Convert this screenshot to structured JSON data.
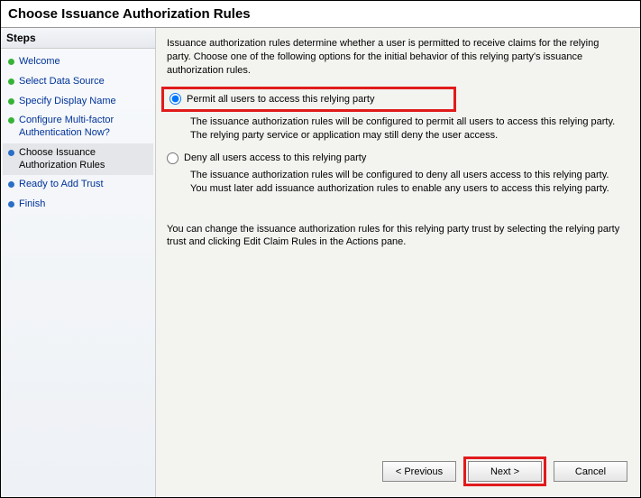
{
  "title": "Choose Issuance Authorization Rules",
  "sidebar": {
    "header": "Steps",
    "items": [
      {
        "label": "Welcome",
        "state": "done"
      },
      {
        "label": "Select Data Source",
        "state": "done"
      },
      {
        "label": "Specify Display Name",
        "state": "done"
      },
      {
        "label": "Configure Multi-factor Authentication Now?",
        "state": "done"
      },
      {
        "label": "Choose Issuance Authorization Rules",
        "state": "current"
      },
      {
        "label": "Ready to Add Trust",
        "state": "todo"
      },
      {
        "label": "Finish",
        "state": "todo"
      }
    ]
  },
  "content": {
    "intro": "Issuance authorization rules determine whether a user is permitted to receive claims for the relying party. Choose one of the following options for the initial behavior of this relying party's issuance authorization rules.",
    "option1": {
      "label": "Permit all users to access this relying party",
      "desc": "The issuance authorization rules will be configured to permit all users to access this relying party. The relying party service or application may still deny the user access."
    },
    "option2": {
      "label": "Deny all users access to this relying party",
      "desc": "The issuance authorization rules will be configured to deny all users access to this relying party. You must later add issuance authorization rules to enable any users to access this relying party."
    },
    "note": "You can change the issuance authorization rules for this relying party trust by selecting the relying party trust and clicking Edit Claim Rules in the Actions pane."
  },
  "buttons": {
    "previous": "< Previous",
    "next": "Next >",
    "cancel": "Cancel"
  }
}
